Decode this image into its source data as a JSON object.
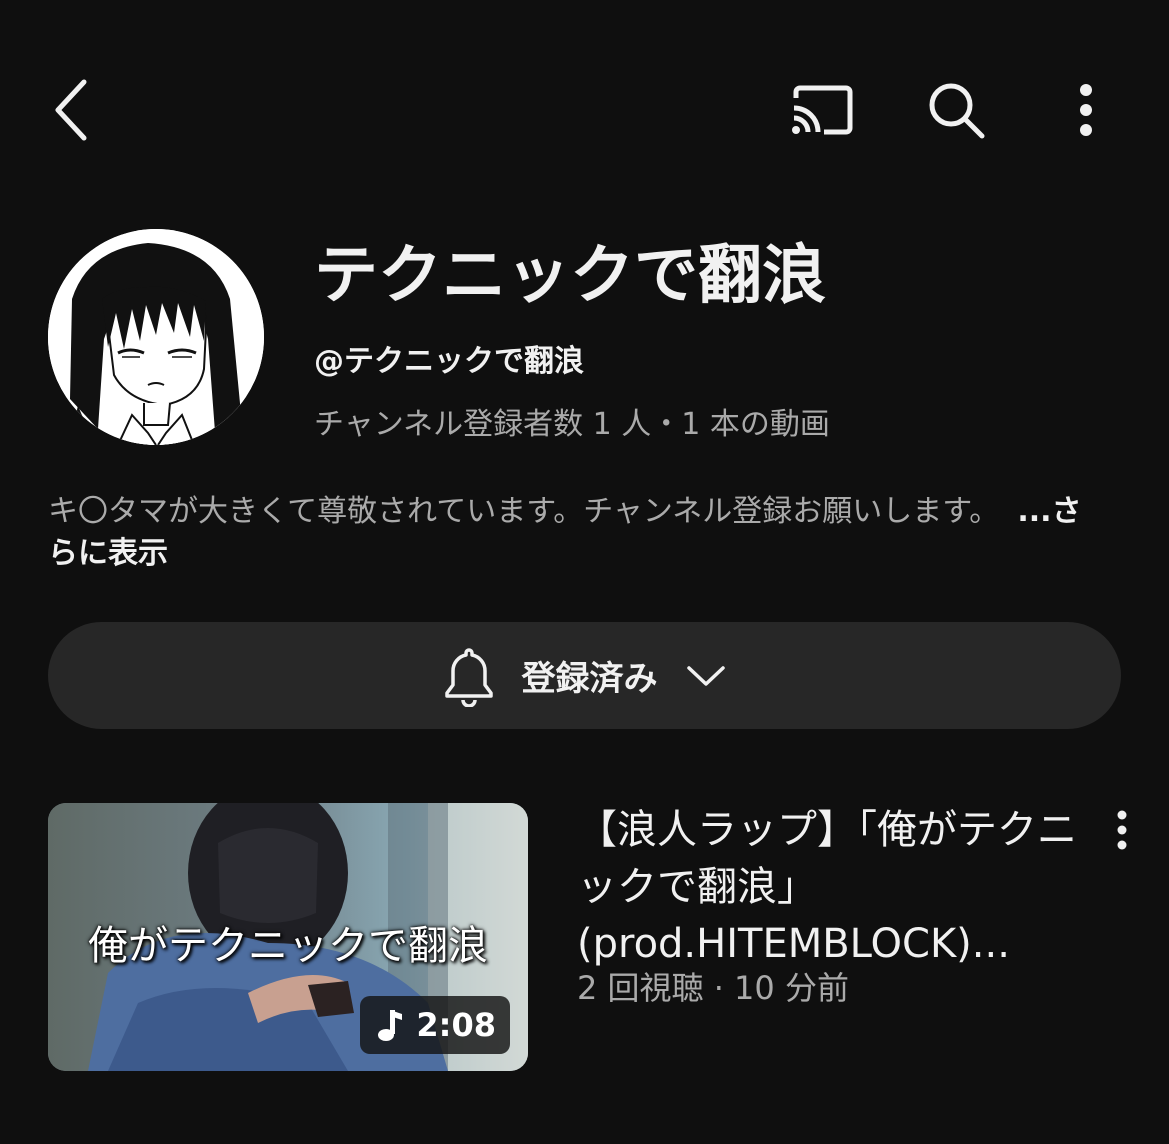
{
  "header": {
    "back_icon": "chevron-left-icon",
    "cast_icon": "cast-icon",
    "search_icon": "search-icon",
    "more_icon": "more-vertical-icon"
  },
  "channel": {
    "name": "テクニックで翻浪",
    "handle": "@テクニックで翻浪",
    "stats": "チャンネル登録者数 1 人・1 本の動画",
    "description": "キ〇タマが大きくて尊敬されています。チャンネル登録お願いします。",
    "show_more": "...さらに表示"
  },
  "subscribe": {
    "label": "登録済み",
    "bell_icon": "bell-icon",
    "dropdown_icon": "chevron-down-icon"
  },
  "video": {
    "thumbnail_caption": "俺がテクニックで翻浪",
    "duration": "2:08",
    "duration_icon": "music-note-icon",
    "title": "【浪人ラップ】「俺がテクニックで翻浪」(prod.HITEMBLOCK)...",
    "meta": "2 回視聴 · 10 分前",
    "more_icon": "more-vertical-icon"
  },
  "colors": {
    "background": "#0f0f0f",
    "primary_text": "#f1f1f1",
    "secondary_text": "#aaaaaa",
    "button_background": "#272727"
  }
}
